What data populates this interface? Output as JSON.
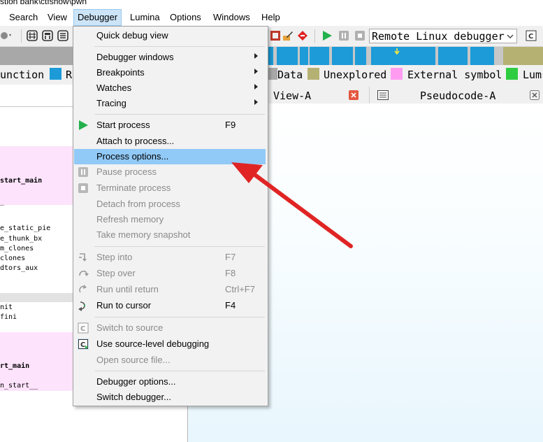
{
  "title_fragment": "stion bank\\ctfshow\\pwn",
  "menubar": {
    "items": [
      "Search",
      "View",
      "Debugger",
      "Lumina",
      "Options",
      "Windows",
      "Help"
    ],
    "active": "Debugger"
  },
  "toolbar": {
    "debugger_select": "Remote Linux debugger"
  },
  "legend": [
    {
      "label": "unction",
      "color": "#1c9bd8"
    },
    {
      "label": "R",
      "color": ""
    },
    {
      "label": "Data",
      "color": "#a8a8a8"
    },
    {
      "label": "Unexplored",
      "color": "#b5b173"
    },
    {
      "label": "External symbol",
      "color": "#ff9cf2"
    },
    {
      "label": "Lum",
      "color": "#2ecc40"
    }
  ],
  "tabs": {
    "ida_view": "View-A",
    "pseudocode": "Pseudocode-A"
  },
  "left_pane": {
    "lines": [
      "start_main",
      "_",
      "e_static_pie",
      "e_thunk_bx",
      "m_clones",
      "clones",
      "dtors_aux",
      "nit",
      "fini",
      "rt_main",
      "n_start__"
    ]
  },
  "dropdown": {
    "items": [
      {
        "label": "Quick debug view",
        "shortcut": "",
        "submenu": false,
        "disabled": false,
        "icon": ""
      },
      {
        "label": "Debugger windows",
        "shortcut": "",
        "submenu": true,
        "disabled": false,
        "icon": ""
      },
      {
        "label": "Breakpoints",
        "shortcut": "",
        "submenu": true,
        "disabled": false,
        "icon": ""
      },
      {
        "label": "Watches",
        "shortcut": "",
        "submenu": true,
        "disabled": false,
        "icon": ""
      },
      {
        "label": "Tracing",
        "shortcut": "",
        "submenu": true,
        "disabled": false,
        "icon": ""
      },
      {
        "label": "Start process",
        "shortcut": "F9",
        "submenu": false,
        "disabled": false,
        "icon": "play-icon"
      },
      {
        "label": "Attach to process...",
        "shortcut": "",
        "submenu": false,
        "disabled": false,
        "icon": ""
      },
      {
        "label": "Process options...",
        "shortcut": "",
        "submenu": false,
        "disabled": false,
        "icon": "",
        "highlighted": true
      },
      {
        "label": "Pause process",
        "shortcut": "",
        "submenu": false,
        "disabled": true,
        "icon": "pause-icon"
      },
      {
        "label": "Terminate process",
        "shortcut": "",
        "submenu": false,
        "disabled": true,
        "icon": "stop-icon"
      },
      {
        "label": "Detach from process",
        "shortcut": "",
        "submenu": false,
        "disabled": true,
        "icon": ""
      },
      {
        "label": "Refresh memory",
        "shortcut": "",
        "submenu": false,
        "disabled": true,
        "icon": ""
      },
      {
        "label": "Take memory snapshot",
        "shortcut": "",
        "submenu": false,
        "disabled": true,
        "icon": ""
      },
      {
        "label": "Step into",
        "shortcut": "F7",
        "submenu": false,
        "disabled": true,
        "icon": "step-into-icon"
      },
      {
        "label": "Step over",
        "shortcut": "F8",
        "submenu": false,
        "disabled": true,
        "icon": "step-over-icon"
      },
      {
        "label": "Run until return",
        "shortcut": "Ctrl+F7",
        "submenu": false,
        "disabled": true,
        "icon": "run-until-return-icon"
      },
      {
        "label": "Run to cursor",
        "shortcut": "F4",
        "submenu": false,
        "disabled": false,
        "icon": "run-to-cursor-icon"
      },
      {
        "label": "Switch to source",
        "shortcut": "",
        "submenu": false,
        "disabled": true,
        "icon": "source-icon"
      },
      {
        "label": "Use source-level debugging",
        "shortcut": "",
        "submenu": false,
        "disabled": false,
        "icon": "source-debug-icon"
      },
      {
        "label": "Open source file...",
        "shortcut": "",
        "submenu": false,
        "disabled": true,
        "icon": ""
      },
      {
        "label": "Debugger options...",
        "shortcut": "",
        "submenu": false,
        "disabled": false,
        "icon": ""
      },
      {
        "label": "Switch debugger...",
        "shortcut": "",
        "submenu": false,
        "disabled": false,
        "icon": ""
      }
    ]
  },
  "colors": {
    "highlight": "#91c9f7",
    "annotation_arrow": "#e02424",
    "nav_blue": "#1c9bd8",
    "nav_olive": "#b5b173"
  }
}
